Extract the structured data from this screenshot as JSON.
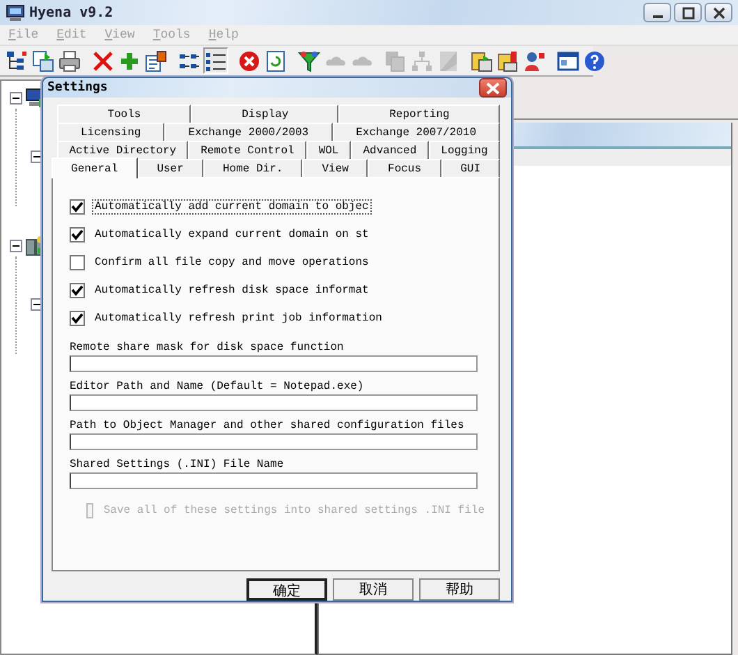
{
  "window": {
    "title": "Hyena v9.2"
  },
  "menu": [
    {
      "label": "File"
    },
    {
      "label": "Edit"
    },
    {
      "label": "View"
    },
    {
      "label": "Tools"
    },
    {
      "label": "Help"
    }
  ],
  "toolbar": [
    {
      "kind": "tree",
      "disabled": false,
      "pressed": false
    },
    {
      "kind": "move",
      "disabled": false,
      "pressed": false
    },
    {
      "kind": "print",
      "disabled": false,
      "pressed": false
    },
    {
      "kind": "separator"
    },
    {
      "kind": "delete",
      "disabled": false,
      "pressed": false
    },
    {
      "kind": "add",
      "disabled": false,
      "pressed": false
    },
    {
      "kind": "properties",
      "disabled": false,
      "pressed": false
    },
    {
      "kind": "separator"
    },
    {
      "kind": "smallicons",
      "disabled": false,
      "pressed": false
    },
    {
      "kind": "details",
      "disabled": false,
      "pressed": true
    },
    {
      "kind": "separator"
    },
    {
      "kind": "stop",
      "disabled": false,
      "pressed": false
    },
    {
      "kind": "refresh",
      "disabled": false,
      "pressed": false
    },
    {
      "kind": "separator"
    },
    {
      "kind": "filter",
      "disabled": false,
      "pressed": false
    },
    {
      "kind": "cloud",
      "disabled": true,
      "pressed": false
    },
    {
      "kind": "cloud",
      "disabled": true,
      "pressed": false
    },
    {
      "kind": "separator"
    },
    {
      "kind": "copy",
      "disabled": true,
      "pressed": false
    },
    {
      "kind": "hierarchy",
      "disabled": true,
      "pressed": false
    },
    {
      "kind": "page",
      "disabled": true,
      "pressed": false
    },
    {
      "kind": "separator"
    },
    {
      "kind": "server",
      "disabled": false,
      "pressed": false
    },
    {
      "kind": "serveralert",
      "disabled": false,
      "pressed": false
    },
    {
      "kind": "user",
      "disabled": false,
      "pressed": false
    },
    {
      "kind": "separator"
    },
    {
      "kind": "window",
      "disabled": false,
      "pressed": false
    },
    {
      "kind": "help",
      "disabled": false,
      "pressed": false
    }
  ],
  "tree": [
    {
      "kind": "computer",
      "expanded": true,
      "children": [
        {
          "expanded": true
        }
      ]
    },
    {
      "kind": "server",
      "expanded": true,
      "children": [
        {
          "expanded": true
        }
      ]
    }
  ],
  "dialog": {
    "title": "Settings",
    "tab_rows": [
      [
        {
          "label": "Tools",
          "selected": false
        },
        {
          "label": "Display",
          "selected": false
        },
        {
          "label": "Reporting",
          "selected": false
        }
      ],
      [
        {
          "label": "Licensing",
          "selected": false
        },
        {
          "label": "Exchange 2000/2003",
          "selected": false
        },
        {
          "label": "Exchange 2007/2010",
          "selected": false
        }
      ],
      [
        {
          "label": "Active Directory",
          "selected": false
        },
        {
          "label": "Remote Control",
          "selected": false
        },
        {
          "label": "WOL",
          "selected": false
        },
        {
          "label": "Advanced",
          "selected": false
        },
        {
          "label": "Logging",
          "selected": false
        }
      ],
      [
        {
          "label": "General",
          "selected": true
        },
        {
          "label": "User",
          "selected": false
        },
        {
          "label": "Home Dir.",
          "selected": false
        },
        {
          "label": "View",
          "selected": false
        },
        {
          "label": "Focus",
          "selected": false
        },
        {
          "label": "GUI",
          "selected": false
        }
      ]
    ],
    "options": [
      {
        "label": "Automatically add current domain to objec",
        "checked": true,
        "focused": true
      },
      {
        "label": "Automatically expand current domain on st",
        "checked": true,
        "focused": false
      },
      {
        "label": "Confirm all file copy and move operations",
        "checked": false,
        "focused": false
      },
      {
        "label": "Automatically refresh disk space informat",
        "checked": true,
        "focused": false
      },
      {
        "label": "Automatically refresh print job information",
        "checked": true,
        "focused": false
      }
    ],
    "fields": [
      {
        "label": "Remote share mask for disk space function"
      },
      {
        "label": "Editor Path and Name (Default = Notepad.exe)"
      },
      {
        "label": "Path to Object Manager and other shared configuration files"
      },
      {
        "label": "Shared Settings (.INI) File Name"
      }
    ],
    "shared_option": {
      "label": "Save all of these settings into shared settings .INI file",
      "checked": false,
      "disabled": true
    },
    "buttons": [
      {
        "label": "确定",
        "default": true
      },
      {
        "label": "取消",
        "default": false
      },
      {
        "label": "帮助",
        "default": false
      }
    ]
  }
}
